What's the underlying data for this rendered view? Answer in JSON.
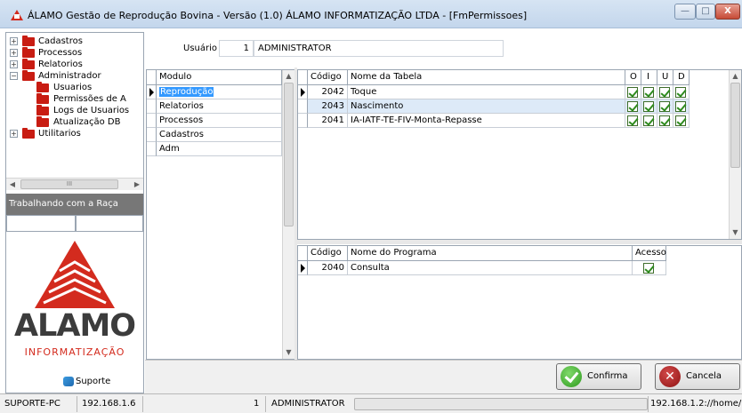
{
  "window": {
    "title": "ÁLAMO Gestão de Reprodução Bovina - Versão (1.0) ÁLAMO INFORMATIZAÇÃO LTDA - [FmPermissoes]",
    "minimize": "—",
    "maximize": "□",
    "close": "X"
  },
  "tree": {
    "items": [
      {
        "label": "Cadastros",
        "expander": "+"
      },
      {
        "label": "Processos",
        "expander": "+"
      },
      {
        "label": "Relatorios",
        "expander": "+"
      },
      {
        "label": "Administrador",
        "expander": "−"
      },
      {
        "label": "Usuarios"
      },
      {
        "label": "Permissões de A"
      },
      {
        "label": "Logs de Usuarios"
      },
      {
        "label": "Atualização DB"
      },
      {
        "label": "Utilitarios",
        "expander": "+"
      }
    ],
    "scroll_grip": "III"
  },
  "raca": {
    "header": "Trabalhando com a Raça"
  },
  "logo": {
    "brand": "ALAMO",
    "sub": "INFORMATIZAÇÃO"
  },
  "suporte": {
    "label": "Suporte"
  },
  "usuario": {
    "label": "Usuário",
    "id": "1",
    "name": "ADMINISTRATOR"
  },
  "modulos": {
    "header": "Modulo",
    "items": [
      "Reprodução",
      "Relatorios",
      "Processos",
      "Cadastros",
      "Adm"
    ]
  },
  "tabelas": {
    "headers": {
      "codigo": "Código",
      "nome": "Nome da Tabela",
      "o": "O",
      "i": "I",
      "u": "U",
      "d": "D"
    },
    "rows": [
      {
        "codigo": "2042",
        "nome": "Toque"
      },
      {
        "codigo": "2043",
        "nome": "Nascimento"
      },
      {
        "codigo": "2041",
        "nome": "IA-IATF-TE-FIV-Monta-Repasse"
      }
    ]
  },
  "programas": {
    "headers": {
      "codigo": "Código",
      "nome": "Nome do Programa",
      "acesso": "Acesso"
    },
    "rows": [
      {
        "codigo": "2040",
        "nome": "Consulta"
      }
    ]
  },
  "buttons": {
    "confirma": "Confirma",
    "cancela": "Cancela",
    "cancel_glyph": "✕"
  },
  "status": {
    "machine": "SUPORTE-PC",
    "ip": "192.168.1.6",
    "user_id": "1",
    "user_name": "ADMINISTRATOR",
    "path": "192.168.1.2://home/"
  }
}
